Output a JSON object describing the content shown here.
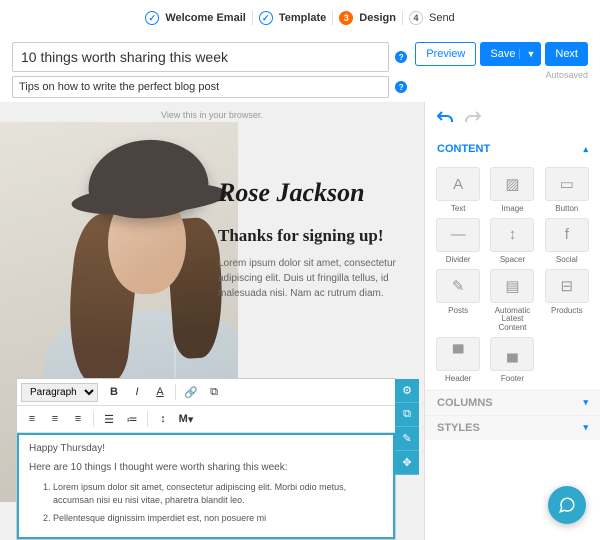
{
  "stepper": [
    {
      "label": "Welcome Email",
      "state": "done"
    },
    {
      "label": "Template",
      "state": "done"
    },
    {
      "label": "Design",
      "state": "active",
      "num": "3"
    },
    {
      "label": "Send",
      "state": "num",
      "num": "4"
    }
  ],
  "subject": {
    "value": "10 things worth sharing this week"
  },
  "preheader": {
    "value": "Tips on how to write the perfect blog post"
  },
  "buttons": {
    "preview": "Preview",
    "save": "Save",
    "next": "Next",
    "autosaved": "Autosaved"
  },
  "canvas": {
    "browser": "View this in your browser.",
    "signature": "Rose Jackson",
    "heading": "Thanks for signing up!",
    "body": "Lorem ipsum dolor sit amet, consectetur adipiscing elit. Duis ut fringilla tellus, id malesuada nisi. Nam ac rutrum diam."
  },
  "editor": {
    "paragraph": "Paragraph",
    "greeting": "Happy Thursday!",
    "intro": "Here are 10 things I thought were worth sharing this week:",
    "items": [
      "Lorem ipsum dolor sit amet, consectetur adipiscing elit. Morbi odio metus, accumsan nisi eu nisi vitae, pharetra blandit leo.",
      "Pellentesque dignissim imperdiet est, non posuere mi"
    ]
  },
  "side": {
    "content": "CONTENT",
    "columns": "COLUMNS",
    "styles": "STYLES",
    "blocks": [
      {
        "k": "text",
        "l": "Text",
        "i": "A"
      },
      {
        "k": "image",
        "l": "Image",
        "i": "▨"
      },
      {
        "k": "button",
        "l": "Button",
        "i": "▭"
      },
      {
        "k": "divider",
        "l": "Divider",
        "i": "—"
      },
      {
        "k": "spacer",
        "l": "Spacer",
        "i": "↕"
      },
      {
        "k": "social",
        "l": "Social",
        "i": "f"
      },
      {
        "k": "posts",
        "l": "Posts",
        "i": "✎"
      },
      {
        "k": "alc",
        "l": "Automatic Latest Content",
        "i": "▤"
      },
      {
        "k": "products",
        "l": "Products",
        "i": "⊟"
      },
      {
        "k": "header",
        "l": "Header",
        "i": "▀"
      },
      {
        "k": "footer",
        "l": "Footer",
        "i": "▄"
      }
    ]
  },
  "gearRail": [
    "⚙",
    "⧉",
    "✎",
    "✥"
  ]
}
